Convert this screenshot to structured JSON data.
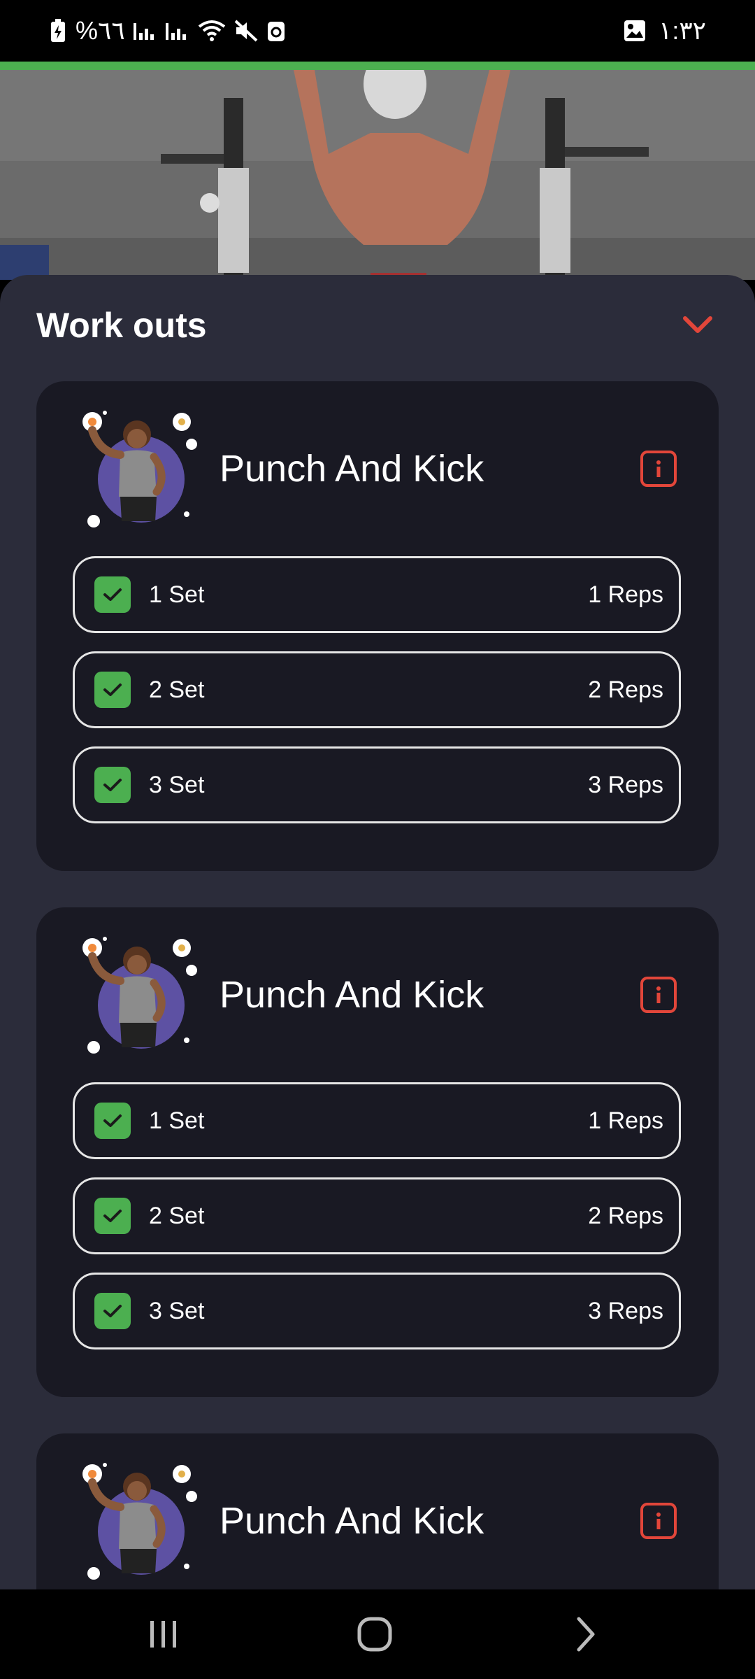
{
  "status_bar": {
    "battery_text": "%٦٦",
    "time": "١:٣٢",
    "icons": [
      "battery-charging-icon",
      "signal-icon",
      "signal-icon",
      "wifi-icon",
      "mute-icon",
      "recycle-icon",
      "gallery-icon"
    ]
  },
  "colors": {
    "accent": "#e2463a",
    "progress": "#4caf50",
    "check": "#4caf50",
    "sheet_bg": "#2b2c3a",
    "card_bg": "#191923"
  },
  "header": {
    "title": "Work outs",
    "collapse_icon": "chevron-down-icon"
  },
  "workouts": [
    {
      "title": "Punch And Kick",
      "sets": [
        {
          "set": "1 Set",
          "reps": "1 Reps"
        },
        {
          "set": "2 Set",
          "reps": "2 Reps"
        },
        {
          "set": "3 Set",
          "reps": "3 Reps"
        }
      ]
    },
    {
      "title": "Punch And Kick",
      "sets": [
        {
          "set": "1 Set",
          "reps": "1 Reps"
        },
        {
          "set": "2 Set",
          "reps": "2 Reps"
        },
        {
          "set": "3 Set",
          "reps": "3 Reps"
        }
      ]
    },
    {
      "title": "Punch And Kick",
      "sets": []
    }
  ],
  "nav": {
    "icons": [
      "recents-icon",
      "home-icon",
      "back-icon"
    ]
  }
}
